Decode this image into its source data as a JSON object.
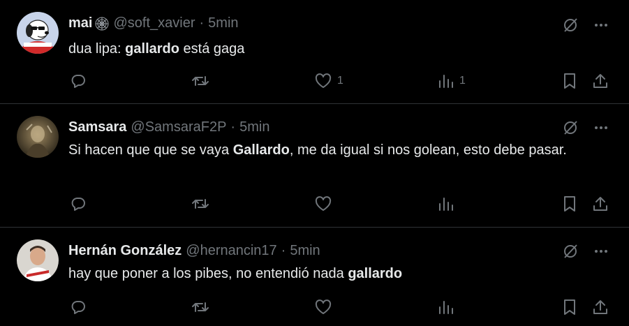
{
  "tweets": [
    {
      "name": "mai",
      "handle": "@soft_xavier",
      "separator": "·",
      "time": "5min",
      "body": [
        {
          "text": "dua lipa: ",
          "bold": false
        },
        {
          "text": "gallardo",
          "bold": true
        },
        {
          "text": " está gaga",
          "bold": false
        }
      ],
      "likes": "1",
      "views": "1"
    },
    {
      "name": "Samsara",
      "handle": "@SamsaraF2P",
      "separator": "·",
      "time": "5min",
      "body": [
        {
          "text": "Si hacen que que se vaya ",
          "bold": false
        },
        {
          "text": "Gallardo",
          "bold": true
        },
        {
          "text": ", me da igual si nos golean, esto debe pasar.",
          "bold": false
        }
      ],
      "likes": "",
      "views": ""
    },
    {
      "name": "Hernán González",
      "handle": "@hernancin17",
      "separator": "·",
      "time": "5min",
      "body": [
        {
          "text": "hay que poner a los pibes, no entendió nada ",
          "bold": false
        },
        {
          "text": "gallardo",
          "bold": true
        }
      ],
      "likes": "",
      "views": ""
    }
  ],
  "icons": {
    "reply": "reply-icon",
    "retweet": "retweet-icon",
    "like": "heart-icon",
    "views": "views-icon",
    "bookmark": "bookmark-icon",
    "share": "share-icon",
    "grok": "grok-icon",
    "more": "more-icon",
    "badge": "spiderweb-icon"
  },
  "colors": {
    "background": "#000000",
    "text": "#e7e9ea",
    "muted": "#71767b",
    "divider": "#2f3336"
  }
}
